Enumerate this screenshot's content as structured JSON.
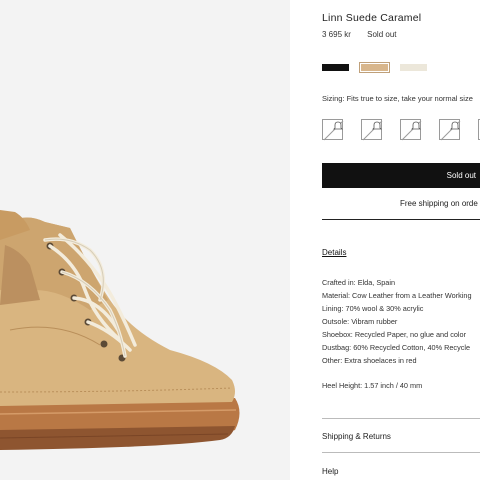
{
  "product": {
    "title": "Linn Suede Caramel",
    "price": "3 695 kr",
    "stock_status": "Sold out"
  },
  "colors": [
    {
      "name": "black-swatch",
      "hex": "#111111"
    },
    {
      "name": "caramel-swatch",
      "hex": "#d8b68c"
    },
    {
      "name": "cream-swatch",
      "hex": "#ece7da"
    }
  ],
  "sizing": {
    "label": "Sizing: Fits true to size, take your normal size",
    "options_note": "size options crossed out (unavailable)"
  },
  "buy_button": {
    "label": "Sold out"
  },
  "shipping_note": "Free shipping on orde",
  "details": {
    "heading": "Details",
    "lines": [
      "Crafted in: Elda, Spain",
      "Material: Cow Leather from a Leather Working",
      "Lining: 70% wool & 30% acrylic",
      "Outsole: Vibram rubber",
      "Shoebox: Recycled Paper, no glue and color",
      "Dustbag: 60% Recycled Cotton, 40% Recycle",
      "Other: Extra shoelaces in red"
    ],
    "heel_height": "Heel Height: 1.57 inch / 40 mm"
  },
  "sections": {
    "shipping_returns": "Shipping & Returns",
    "help": "Help"
  },
  "image": {
    "subject": "caramel suede hiking boot with cream laces"
  }
}
